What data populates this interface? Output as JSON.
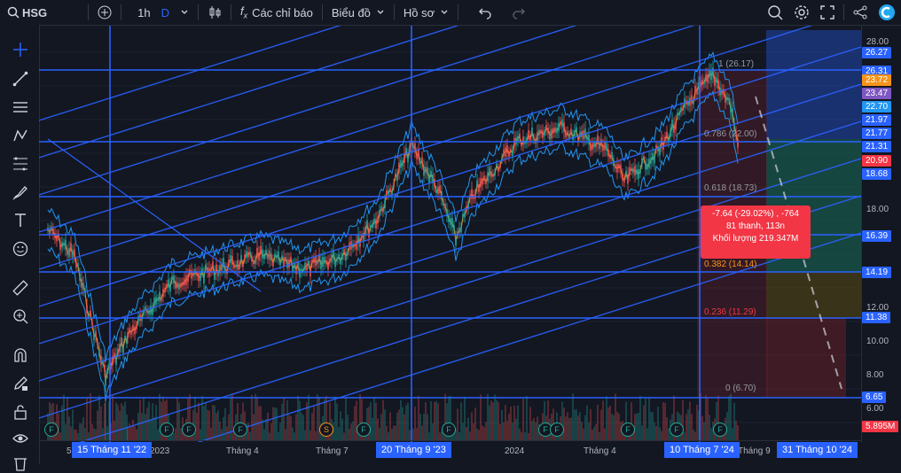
{
  "toolbar": {
    "symbol": "HSG",
    "interval": "1h",
    "interval_alt": "D",
    "indicators_label": "Các chỉ báo",
    "chart_type_label": "Biểu đồ",
    "profile_label": "Hồ sơ"
  },
  "price_scale": {
    "plain": [
      "28.00",
      "22.00",
      "20.00",
      "18.00",
      "12.00",
      "10.00",
      "8.00",
      "6.00"
    ],
    "highlighted": [
      {
        "value": "26.27",
        "color": "#2962ff"
      },
      {
        "value": "26.31",
        "color": "#2962ff"
      },
      {
        "value": "23.72",
        "color": "#f7931a"
      },
      {
        "value": "23.47",
        "color": "#7e57c2"
      },
      {
        "value": "22.70",
        "color": "#2196f3"
      },
      {
        "value": "21.97",
        "color": "#2962ff"
      },
      {
        "value": "21.77",
        "color": "#2962ff"
      },
      {
        "value": "21.31",
        "color": "#2962ff"
      },
      {
        "value": "20.90",
        "color": "#f23645"
      },
      {
        "value": "18.68",
        "color": "#2962ff"
      },
      {
        "value": "16.39",
        "color": "#2962ff"
      },
      {
        "value": "14.19",
        "color": "#2962ff"
      },
      {
        "value": "11.38",
        "color": "#2962ff"
      },
      {
        "value": "6.65",
        "color": "#2962ff"
      },
      {
        "value": "5.895M",
        "color": "#f23645"
      }
    ]
  },
  "time_axis": {
    "plain": [
      "5",
      "2023",
      "Tháng 4",
      "Tháng 7",
      "2024",
      "Tháng 4",
      "Tháng 9"
    ],
    "highlighted": [
      "15 Tháng 11 '22",
      "20 Tháng 9 '23",
      "10 Tháng 7 '24",
      "31 Tháng 10 '24"
    ]
  },
  "fib_levels": [
    {
      "label": "1 (26.17)",
      "color": "#9598a1"
    },
    {
      "label": "0.786 (22.00)",
      "color": "#9598a1"
    },
    {
      "label": "0.618 (18.73)",
      "color": "#9598a1"
    },
    {
      "label": "0.382 (14.14)",
      "color": "#f7931a"
    },
    {
      "label": "0.236 (11.29)",
      "color": "#f23645"
    },
    {
      "label": "0 (6.70)",
      "color": "#9598a1"
    }
  ],
  "measure_tooltip": {
    "line1": "-7.64 (-29.02%) , -764",
    "line2": "81 thanh, 113n",
    "line3": "Khối lượng 219.347M"
  },
  "event_markers": [
    "F",
    "F",
    "F",
    "F",
    "S",
    "F",
    "F",
    "F",
    "F",
    "F",
    "F",
    "F"
  ]
}
